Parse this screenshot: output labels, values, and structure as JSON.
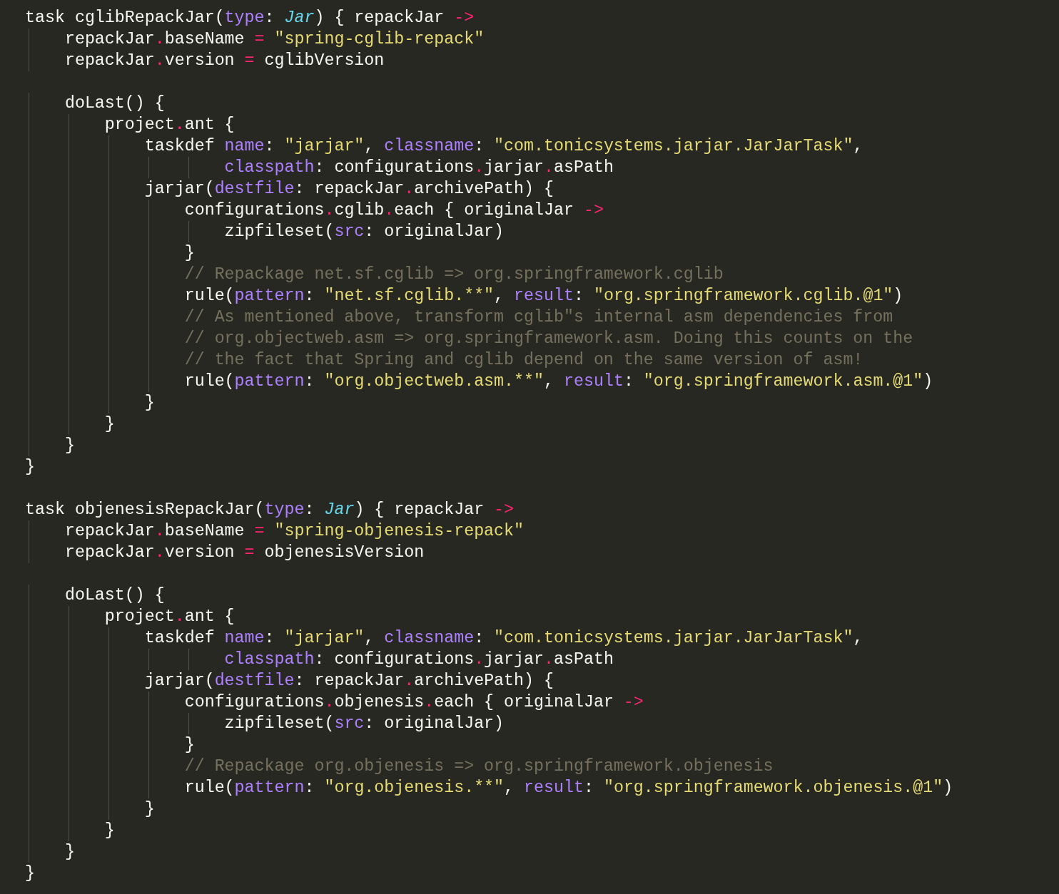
{
  "editor": {
    "lines": [
      {
        "kind": "code",
        "tokens": [
          {
            "kind": "plain",
            "text": "task cglibRepackJar("
          },
          {
            "kind": "attr",
            "text": "type"
          },
          {
            "kind": "plain",
            "text": ": "
          },
          {
            "kind": "type",
            "text": "Jar"
          },
          {
            "kind": "plain",
            "text": ") { repackJar "
          },
          {
            "kind": "op",
            "text": "->"
          }
        ]
      },
      {
        "kind": "code",
        "tokens": [
          {
            "kind": "plain",
            "text": "    repackJar"
          },
          {
            "kind": "member",
            "text": ".baseName "
          },
          {
            "kind": "op",
            "text": "="
          },
          {
            "kind": "string",
            "text": " \"spring-cglib-repack\""
          }
        ]
      },
      {
        "kind": "code",
        "tokens": [
          {
            "kind": "plain",
            "text": "    repackJar"
          },
          {
            "kind": "member",
            "text": ".version "
          },
          {
            "kind": "op",
            "text": "="
          },
          {
            "kind": "plain",
            "text": " cglibVersion"
          }
        ]
      },
      {
        "kind": "blank"
      },
      {
        "kind": "code",
        "tokens": [
          {
            "kind": "plain",
            "text": "    doLast() {"
          }
        ]
      },
      {
        "kind": "code",
        "tokens": [
          {
            "kind": "plain",
            "text": "        project"
          },
          {
            "kind": "member",
            "text": ".ant {"
          }
        ]
      },
      {
        "kind": "code",
        "tokens": [
          {
            "kind": "plain",
            "text": "            taskdef "
          },
          {
            "kind": "attr",
            "text": "name"
          },
          {
            "kind": "plain",
            "text": ": "
          },
          {
            "kind": "string",
            "text": "\"jarjar\""
          },
          {
            "kind": "plain",
            "text": ", "
          },
          {
            "kind": "attr",
            "text": "classname"
          },
          {
            "kind": "plain",
            "text": ": "
          },
          {
            "kind": "string",
            "text": "\"com.tonicsystems.jarjar.JarJarTask\""
          },
          {
            "kind": "plain",
            "text": ","
          }
        ]
      },
      {
        "kind": "code",
        "tokens": [
          {
            "kind": "attr",
            "text": "                    classpath"
          },
          {
            "kind": "plain",
            "text": ": configurations"
          },
          {
            "kind": "member",
            "text": ".jarjar"
          },
          {
            "kind": "member",
            "text": ".asPath"
          }
        ]
      },
      {
        "kind": "code",
        "tokens": [
          {
            "kind": "plain",
            "text": "            jarjar("
          },
          {
            "kind": "attr",
            "text": "destfile"
          },
          {
            "kind": "plain",
            "text": ": repackJar"
          },
          {
            "kind": "member",
            "text": ".archivePath) {"
          }
        ]
      },
      {
        "kind": "code",
        "tokens": [
          {
            "kind": "plain",
            "text": "                configurations"
          },
          {
            "kind": "member",
            "text": ".cglib"
          },
          {
            "kind": "member",
            "text": ".each { originalJar "
          },
          {
            "kind": "op",
            "text": "->"
          }
        ]
      },
      {
        "kind": "code",
        "tokens": [
          {
            "kind": "plain",
            "text": "                    zipfileset("
          },
          {
            "kind": "attr",
            "text": "src"
          },
          {
            "kind": "plain",
            "text": ": originalJar)"
          }
        ]
      },
      {
        "kind": "code",
        "tokens": [
          {
            "kind": "plain",
            "text": "                }"
          }
        ]
      },
      {
        "kind": "code",
        "tokens": [
          {
            "kind": "comment",
            "text": "                // Repackage net.sf.cglib => org.springframework.cglib"
          }
        ]
      },
      {
        "kind": "code",
        "tokens": [
          {
            "kind": "plain",
            "text": "                rule("
          },
          {
            "kind": "attr",
            "text": "pattern"
          },
          {
            "kind": "plain",
            "text": ": "
          },
          {
            "kind": "string",
            "text": "\"net.sf.cglib.**\""
          },
          {
            "kind": "plain",
            "text": ", "
          },
          {
            "kind": "attr",
            "text": "result"
          },
          {
            "kind": "plain",
            "text": ": "
          },
          {
            "kind": "string",
            "text": "\"org.springframework.cglib.@1\""
          },
          {
            "kind": "plain",
            "text": ")"
          }
        ]
      },
      {
        "kind": "code",
        "tokens": [
          {
            "kind": "comment",
            "text": "                // As mentioned above, transform cglib\"s internal asm dependencies from"
          }
        ]
      },
      {
        "kind": "code",
        "tokens": [
          {
            "kind": "comment",
            "text": "                // org.objectweb.asm => org.springframework.asm. Doing this counts on the"
          }
        ]
      },
      {
        "kind": "code",
        "tokens": [
          {
            "kind": "comment",
            "text": "                // the fact that Spring and cglib depend on the same version of asm!"
          }
        ]
      },
      {
        "kind": "code",
        "tokens": [
          {
            "kind": "plain",
            "text": "                rule("
          },
          {
            "kind": "attr",
            "text": "pattern"
          },
          {
            "kind": "plain",
            "text": ": "
          },
          {
            "kind": "string",
            "text": "\"org.objectweb.asm.**\""
          },
          {
            "kind": "plain",
            "text": ", "
          },
          {
            "kind": "attr",
            "text": "result"
          },
          {
            "kind": "plain",
            "text": ": "
          },
          {
            "kind": "string",
            "text": "\"org.springframework.asm.@1\""
          },
          {
            "kind": "plain",
            "text": ")"
          }
        ]
      },
      {
        "kind": "code",
        "tokens": [
          {
            "kind": "plain",
            "text": "            }"
          }
        ]
      },
      {
        "kind": "code",
        "tokens": [
          {
            "kind": "plain",
            "text": "        }"
          }
        ]
      },
      {
        "kind": "code",
        "tokens": [
          {
            "kind": "plain",
            "text": "    }"
          }
        ]
      },
      {
        "kind": "code",
        "tokens": [
          {
            "kind": "plain",
            "text": "}"
          }
        ]
      },
      {
        "kind": "blank"
      },
      {
        "kind": "code",
        "tokens": [
          {
            "kind": "plain",
            "text": "task objenesisRepackJar("
          },
          {
            "kind": "attr",
            "text": "type"
          },
          {
            "kind": "plain",
            "text": ": "
          },
          {
            "kind": "type",
            "text": "Jar"
          },
          {
            "kind": "plain",
            "text": ") { repackJar "
          },
          {
            "kind": "op",
            "text": "->"
          }
        ]
      },
      {
        "kind": "code",
        "tokens": [
          {
            "kind": "plain",
            "text": "    repackJar"
          },
          {
            "kind": "member",
            "text": ".baseName "
          },
          {
            "kind": "op",
            "text": "="
          },
          {
            "kind": "string",
            "text": " \"spring-objenesis-repack\""
          }
        ]
      },
      {
        "kind": "code",
        "tokens": [
          {
            "kind": "plain",
            "text": "    repackJar"
          },
          {
            "kind": "member",
            "text": ".version "
          },
          {
            "kind": "op",
            "text": "="
          },
          {
            "kind": "plain",
            "text": " objenesisVersion"
          }
        ]
      },
      {
        "kind": "blank"
      },
      {
        "kind": "code",
        "tokens": [
          {
            "kind": "plain",
            "text": "    doLast() {"
          }
        ]
      },
      {
        "kind": "code",
        "tokens": [
          {
            "kind": "plain",
            "text": "        project"
          },
          {
            "kind": "member",
            "text": ".ant {"
          }
        ]
      },
      {
        "kind": "code",
        "tokens": [
          {
            "kind": "plain",
            "text": "            taskdef "
          },
          {
            "kind": "attr",
            "text": "name"
          },
          {
            "kind": "plain",
            "text": ": "
          },
          {
            "kind": "string",
            "text": "\"jarjar\""
          },
          {
            "kind": "plain",
            "text": ", "
          },
          {
            "kind": "attr",
            "text": "classname"
          },
          {
            "kind": "plain",
            "text": ": "
          },
          {
            "kind": "string",
            "text": "\"com.tonicsystems.jarjar.JarJarTask\""
          },
          {
            "kind": "plain",
            "text": ","
          }
        ]
      },
      {
        "kind": "code",
        "tokens": [
          {
            "kind": "attr",
            "text": "                    classpath"
          },
          {
            "kind": "plain",
            "text": ": configurations"
          },
          {
            "kind": "member",
            "text": ".jarjar"
          },
          {
            "kind": "member",
            "text": ".asPath"
          }
        ]
      },
      {
        "kind": "code",
        "tokens": [
          {
            "kind": "plain",
            "text": "            jarjar("
          },
          {
            "kind": "attr",
            "text": "destfile"
          },
          {
            "kind": "plain",
            "text": ": repackJar"
          },
          {
            "kind": "member",
            "text": ".archivePath) {"
          }
        ]
      },
      {
        "kind": "code",
        "tokens": [
          {
            "kind": "plain",
            "text": "                configurations"
          },
          {
            "kind": "member",
            "text": ".objenesis"
          },
          {
            "kind": "member",
            "text": ".each { originalJar "
          },
          {
            "kind": "op",
            "text": "->"
          }
        ]
      },
      {
        "kind": "code",
        "tokens": [
          {
            "kind": "plain",
            "text": "                    zipfileset("
          },
          {
            "kind": "attr",
            "text": "src"
          },
          {
            "kind": "plain",
            "text": ": originalJar)"
          }
        ]
      },
      {
        "kind": "code",
        "tokens": [
          {
            "kind": "plain",
            "text": "                }"
          }
        ]
      },
      {
        "kind": "code",
        "tokens": [
          {
            "kind": "comment",
            "text": "                // Repackage org.objenesis => org.springframework.objenesis"
          }
        ]
      },
      {
        "kind": "code",
        "tokens": [
          {
            "kind": "plain",
            "text": "                rule("
          },
          {
            "kind": "attr",
            "text": "pattern"
          },
          {
            "kind": "plain",
            "text": ": "
          },
          {
            "kind": "string",
            "text": "\"org.objenesis.**\""
          },
          {
            "kind": "plain",
            "text": ", "
          },
          {
            "kind": "attr",
            "text": "result"
          },
          {
            "kind": "plain",
            "text": ": "
          },
          {
            "kind": "string",
            "text": "\"org.springframework.objenesis.@1\""
          },
          {
            "kind": "plain",
            "text": ")"
          }
        ]
      },
      {
        "kind": "code",
        "tokens": [
          {
            "kind": "plain",
            "text": "            }"
          }
        ]
      },
      {
        "kind": "code",
        "tokens": [
          {
            "kind": "plain",
            "text": "        }"
          }
        ]
      },
      {
        "kind": "code",
        "tokens": [
          {
            "kind": "plain",
            "text": "    }"
          }
        ]
      },
      {
        "kind": "code",
        "tokens": [
          {
            "kind": "plain",
            "text": "}"
          }
        ]
      }
    ]
  }
}
